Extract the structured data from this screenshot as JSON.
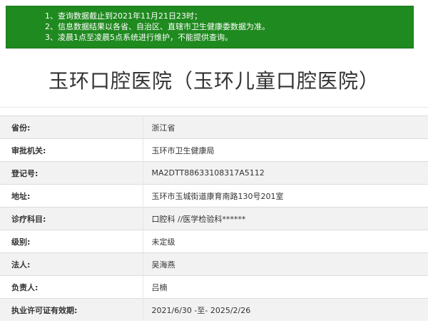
{
  "notice": {
    "lines": [
      "1、查询数据截止到2021年11月21日23时；",
      "2、信息数据结果以各省、自治区、直辖市卫生健康委数据为准。",
      "3、凌晨1点至凌晨5点系统进行维护，不能提供查询。"
    ],
    "background_color": "#1f8a1f"
  },
  "page_title": "玉环口腔医院（玉环儿童口腔医院）",
  "details": {
    "rows": [
      {
        "label": "省份:",
        "value": "浙江省"
      },
      {
        "label": "审批机关:",
        "value": "玉环市卫生健康局"
      },
      {
        "label": "登记号:",
        "value": "MA2DTT88633108317A5112"
      },
      {
        "label": "地址:",
        "value": "玉环市玉城街道康育南路130号201室"
      },
      {
        "label": "诊疗科目:",
        "value": "口腔科 //医学检验科******"
      },
      {
        "label": "级别:",
        "value": "未定级"
      },
      {
        "label": "法人:",
        "value": "吴海燕"
      },
      {
        "label": "负责人:",
        "value": "吕楠"
      },
      {
        "label": "执业许可证有效期:",
        "value": "2021/6/30 -至- 2025/2/26"
      }
    ]
  }
}
